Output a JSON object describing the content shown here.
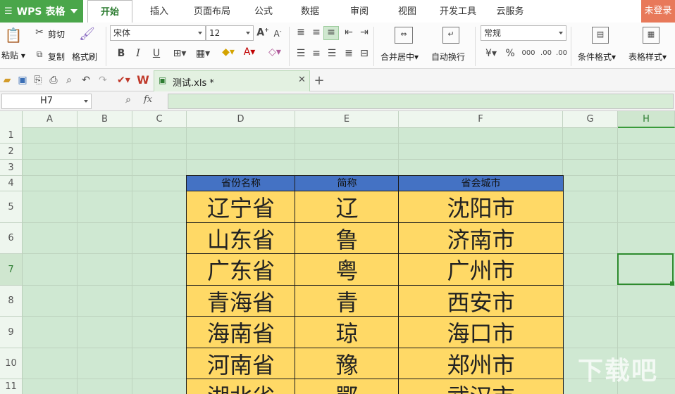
{
  "app": {
    "title": "WPS 表格"
  },
  "menu": {
    "tabs": [
      "开始",
      "插入",
      "页面布局",
      "公式",
      "数据",
      "审阅",
      "视图",
      "开发工具",
      "云服务"
    ],
    "login": "未登录"
  },
  "ribbon": {
    "paste": "粘贴",
    "cut": "剪切",
    "copy": "复制",
    "format_painter": "格式刷",
    "font_name": "宋体",
    "font_size": "12",
    "merge_center": "合并居中",
    "wrap_text": "自动换行",
    "number_format": "常规",
    "percent": "%",
    "comma": "000",
    "dec_inc": ".00",
    "dec_dec": ".00",
    "conditional_format": "条件格式",
    "table_style": "表格样式",
    "bold": "B",
    "italic": "I",
    "underline": "U",
    "font_color_glyph": "A",
    "font_grow": "A",
    "font_shrink": "A"
  },
  "doc_tab": {
    "name": "测试.xls *"
  },
  "formula_bar": {
    "cell_ref": "H7",
    "fx": "fx"
  },
  "grid": {
    "columns": [
      "A",
      "B",
      "C",
      "D",
      "E",
      "F",
      "G",
      "H"
    ],
    "rows": [
      "1",
      "2",
      "3",
      "4",
      "5",
      "6",
      "7",
      "8",
      "9",
      "10",
      "11"
    ],
    "active_column": "H",
    "active_row": "7"
  },
  "table": {
    "headers": [
      "省份名称",
      "简称",
      "省会城市"
    ],
    "rows": [
      [
        "辽宁省",
        "辽",
        "沈阳市"
      ],
      [
        "山东省",
        "鲁",
        "济南市"
      ],
      [
        "广东省",
        "粤",
        "广州市"
      ],
      [
        "青海省",
        "青",
        "西安市"
      ],
      [
        "海南省",
        "琼",
        "海口市"
      ],
      [
        "河南省",
        "豫",
        "郑州市"
      ],
      [
        "湖北省",
        "鄂",
        "武汉市"
      ]
    ]
  },
  "colors": {
    "accent_green": "#4aa64a",
    "sheet_bg": "#cfe8d2",
    "header_blue": "#4472c4",
    "cell_yellow": "#ffd966",
    "login_orange": "#e8795a"
  },
  "watermark": "下载吧"
}
